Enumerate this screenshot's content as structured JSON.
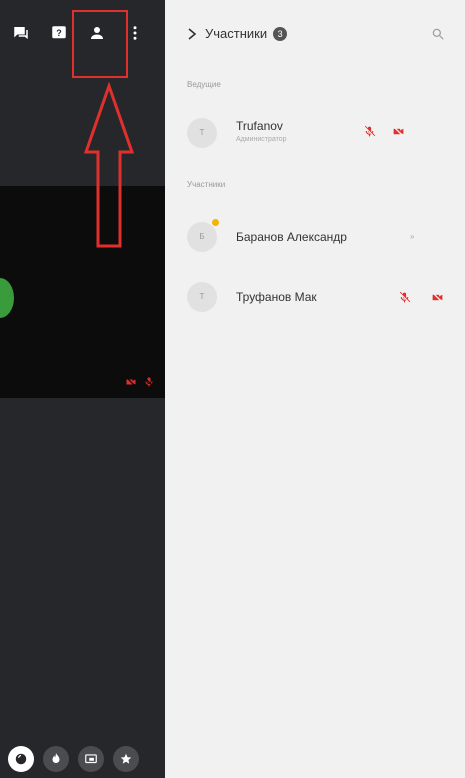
{
  "toolbar": {
    "icons": [
      "chat-icon",
      "question-icon",
      "participants-icon",
      "more-vertical-icon"
    ]
  },
  "panel": {
    "title": "Участники",
    "count_badge": "3",
    "hosts_section": "Ведущие",
    "participants_section": "Участники",
    "participants": [
      {
        "initial": "T",
        "name": "Trufanov",
        "role": "Администратор",
        "mic": "muted",
        "camera": "off"
      },
      {
        "initial": "Б",
        "name": "Баранов Александр",
        "extra": "»",
        "hand_raised": true
      },
      {
        "initial": "T",
        "name": "Труфанов Мак",
        "mic": "muted",
        "camera": "off"
      }
    ]
  },
  "colors": {
    "accent_red": "#e0302e",
    "left_bg": "#25272b",
    "panel_bg": "#f1f1f1",
    "video_bg": "#0c0c0c"
  },
  "bottom_bar": {
    "icons": [
      "reaction-icon",
      "fire-icon",
      "screen-share-icon",
      "star-icon"
    ]
  }
}
